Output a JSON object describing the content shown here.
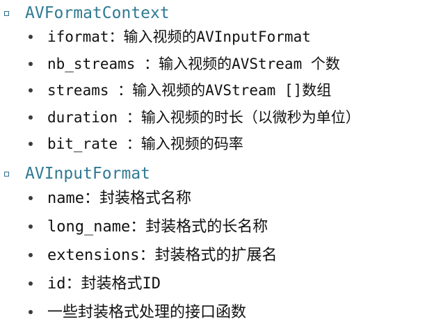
{
  "sections": [
    {
      "title": "AVFormatContext",
      "items": [
        "iformat：输入视频的AVInputFormat",
        "nb_streams ：输入视频的AVStream 个数",
        "streams ：输入视频的AVStream []数组",
        "duration ：输入视频的时长（以微秒为单位）",
        "bit_rate ：输入视频的码率"
      ]
    },
    {
      "title": "AVInputFormat",
      "items": [
        "name：封装格式名称",
        "long_name：封装格式的长名称",
        "extensions：封装格式的扩展名",
        "id：封装格式ID",
        "一些封装格式处理的接口函数"
      ]
    }
  ],
  "colors": {
    "heading": "#2f7a92",
    "body_text": "#111111",
    "background": "#ffffff"
  },
  "icons": {
    "section_marker": "square-outline-bullet-icon",
    "item_marker": "dot-bullet-icon"
  }
}
